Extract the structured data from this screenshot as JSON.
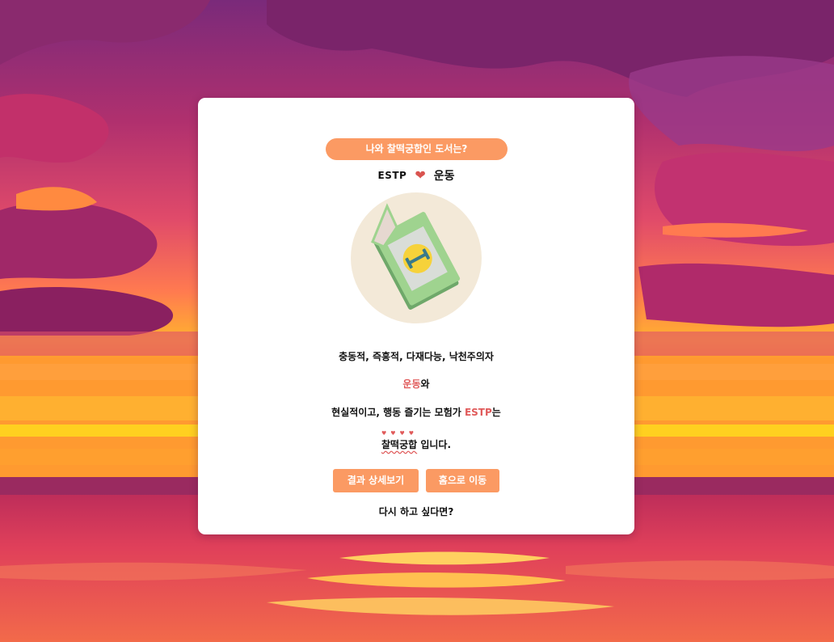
{
  "header": {
    "title": "나와 찰떡궁합인 도서는?"
  },
  "match": {
    "mbti": "ESTP",
    "book": "운동"
  },
  "description": {
    "line1": "충동적, 즉흥적, 다재다능, 낙천주의자",
    "book_word": "운동",
    "book_suffix": "와",
    "line3_prefix": "현실적이고, 행동 즐기는 모험가 ",
    "line3_mbti": "ESTP",
    "line3_suffix": "는",
    "result_word": "찰떡궁합",
    "result_suffix": " 입니다."
  },
  "buttons": {
    "detail_label": "결과 상세보기",
    "home_label": "홈으로 이동"
  },
  "footer": {
    "retry_text": "다시 하고 싶다면?"
  },
  "colors": {
    "accent": "#fb9a63",
    "highlight": "#e05a5a",
    "card": "#ffffff"
  },
  "icons": {
    "heart": "heart-icon",
    "illustration": "exercise-book-icon"
  }
}
